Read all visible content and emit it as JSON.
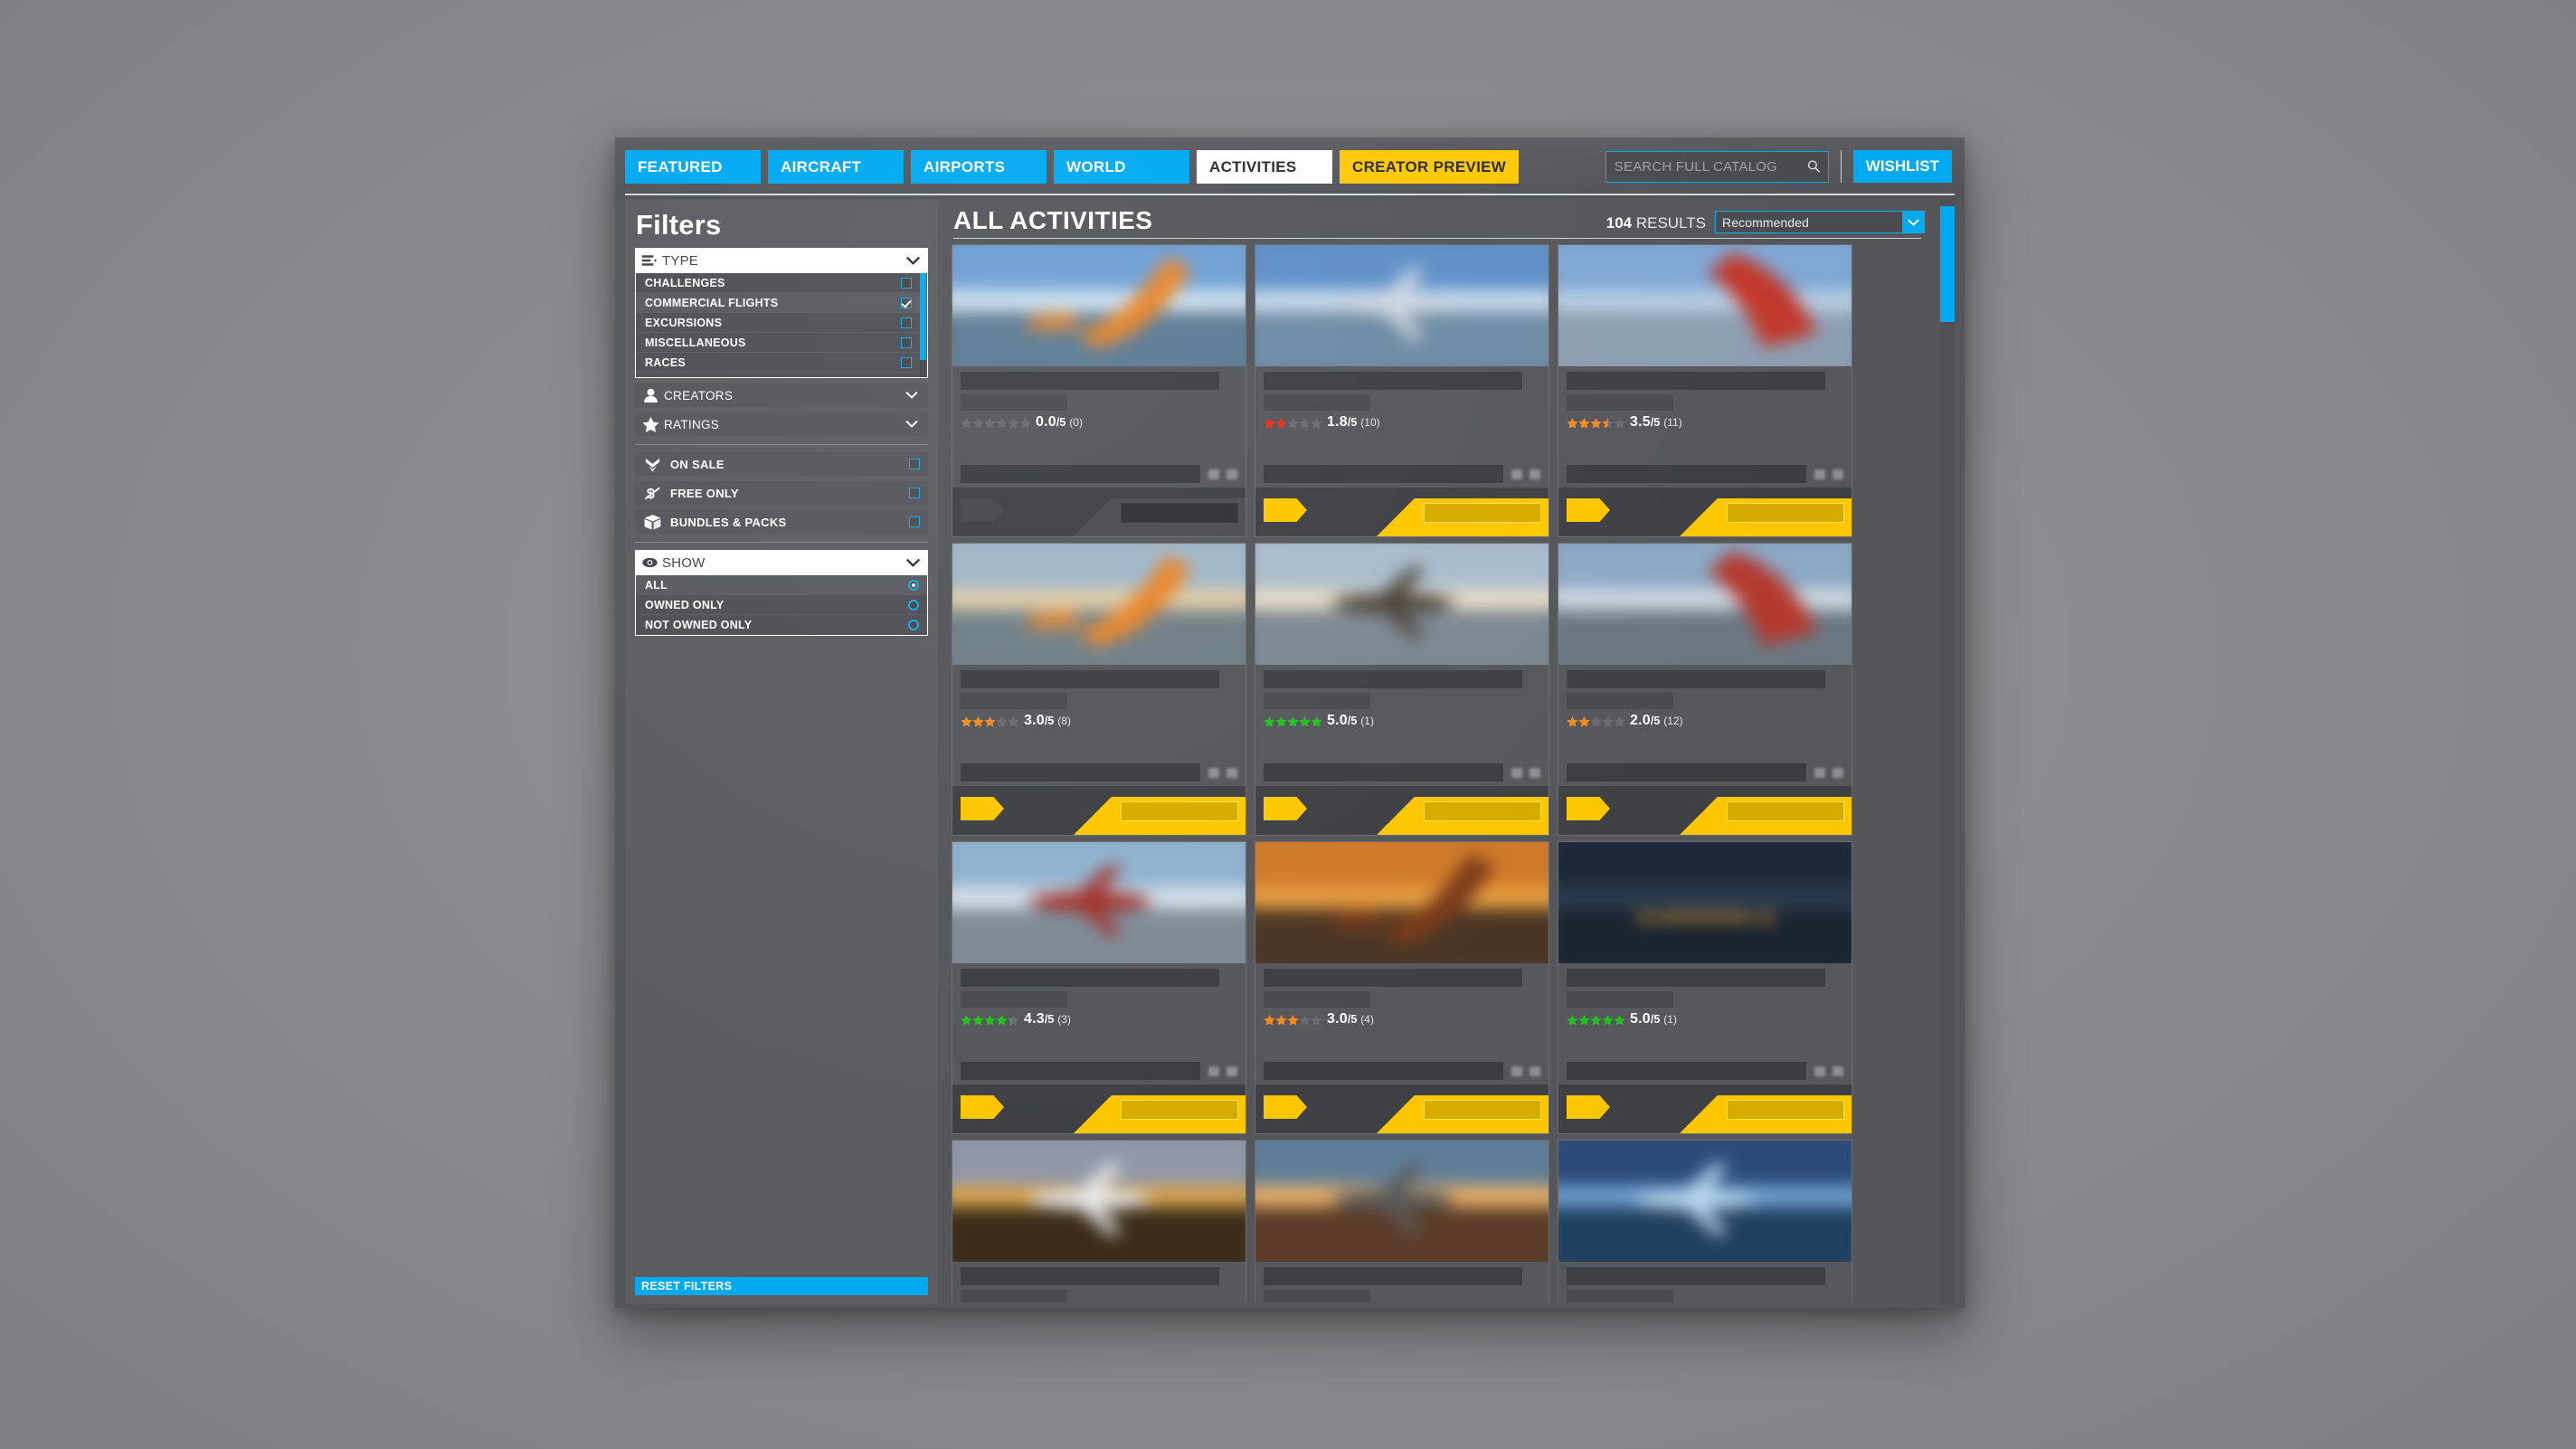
{
  "nav": {
    "tabs": [
      {
        "label": "FEATURED",
        "active": false
      },
      {
        "label": "AIRCRAFT",
        "active": false
      },
      {
        "label": "AIRPORTS",
        "active": false
      },
      {
        "label": "WORLD",
        "active": false
      },
      {
        "label": "ACTIVITIES",
        "active": true
      }
    ],
    "creator_preview": "CREATOR PREVIEW",
    "wishlist": "WISHLIST",
    "search_placeholder": "SEARCH FULL CATALOG",
    "search_value": ""
  },
  "sidebar": {
    "title": "Filters",
    "type_section": {
      "label": "TYPE",
      "icon": "list-icon",
      "options": [
        {
          "label": "CHALLENGES",
          "checked": false
        },
        {
          "label": "COMMERCIAL FLIGHTS",
          "checked": true
        },
        {
          "label": "EXCURSIONS",
          "checked": false
        },
        {
          "label": "MISCELLANEOUS",
          "checked": false
        },
        {
          "label": "RACES",
          "checked": false
        }
      ]
    },
    "collapsed_sections": [
      {
        "label": "CREATORS",
        "icon": "person-icon"
      },
      {
        "label": "RATINGS",
        "icon": "star-icon"
      }
    ],
    "toggles": [
      {
        "label": "ON SALE",
        "icon": "double-chevron-down-icon",
        "checked": false
      },
      {
        "label": "FREE ONLY",
        "icon": "no-money-icon",
        "checked": false
      },
      {
        "label": "BUNDLES & PACKS",
        "icon": "box-icon",
        "checked": false
      }
    ],
    "show_section": {
      "label": "SHOW",
      "icon": "eye-icon",
      "options": [
        {
          "label": "ALL",
          "selected": true
        },
        {
          "label": "OWNED ONLY",
          "selected": false
        },
        {
          "label": "NOT OWNED ONLY",
          "selected": false
        }
      ]
    },
    "reset_label": "RESET FILTERS"
  },
  "main": {
    "page_title": "ALL ACTIVITIES",
    "results_count": "104",
    "results_label": "RESULTS",
    "sort_value": "Recommended",
    "cards": [
      {
        "rating": "0.0",
        "denominator": "/5",
        "count": "(0)",
        "stars": 0,
        "star_color": "#6d6e72",
        "placeholder_action": true,
        "img": {
          "sky_top": "#6d9fd4",
          "sky_mid": "#cfe3f2",
          "ground": "#5c7b93",
          "accent": "#e8862a",
          "accent_shape": "wing"
        }
      },
      {
        "rating": "1.8",
        "denominator": "/5",
        "count": "(10)",
        "stars": 2,
        "star_color": "#f02b17",
        "placeholder_action": false,
        "img": {
          "sky_top": "#5d8fc7",
          "sky_mid": "#c9dcee",
          "ground": "#6d8aa3",
          "accent": "#cfd8e2",
          "accent_shape": "plane"
        }
      },
      {
        "rating": "3.5",
        "denominator": "/5",
        "count": "(11)",
        "stars": 3.5,
        "star_color": "#f08b1e",
        "placeholder_action": false,
        "img": {
          "sky_top": "#7fa8d4",
          "sky_mid": "#b7cee4",
          "ground": "#8d9fb3",
          "accent": "#c0392b",
          "accent_shape": "tail"
        }
      },
      {
        "rating": "3.0",
        "denominator": "/5",
        "count": "(8)",
        "stars": 3,
        "star_color": "#f08b1e",
        "placeholder_action": false,
        "img": {
          "sky_top": "#9fb7c9",
          "sky_mid": "#e0cda8",
          "ground": "#6f7f87",
          "accent": "#e8862a",
          "accent_shape": "wing"
        }
      },
      {
        "rating": "5.0",
        "denominator": "/5",
        "count": "(1)",
        "stars": 5,
        "star_color": "#22c01e",
        "placeholder_action": false,
        "img": {
          "sky_top": "#a8bccd",
          "sky_mid": "#e8ddc8",
          "ground": "#7b8790",
          "accent": "#4a4238",
          "accent_shape": "plane"
        }
      },
      {
        "rating": "2.0",
        "denominator": "/5",
        "count": "(12)",
        "stars": 2,
        "star_color": "#f08b1e",
        "placeholder_action": false,
        "img": {
          "sky_top": "#8ca8c4",
          "sky_mid": "#cfd9e2",
          "ground": "#6a7782",
          "accent": "#b33a2e",
          "accent_shape": "tail"
        }
      },
      {
        "rating": "4.3",
        "denominator": "/5",
        "count": "(3)",
        "stars": 4.3,
        "star_color": "#22c01e",
        "placeholder_action": false,
        "img": {
          "sky_top": "#8fb2cf",
          "sky_mid": "#d6e2ec",
          "ground": "#7e8c98",
          "accent": "#a03028",
          "accent_shape": "plane"
        }
      },
      {
        "rating": "3.0",
        "denominator": "/5",
        "count": "(4)",
        "stars": 3,
        "star_color": "#f08b1e",
        "placeholder_action": false,
        "img": {
          "sky_top": "#d07a2a",
          "sky_mid": "#e8a040",
          "ground": "#4a3524",
          "accent": "#7a3a18",
          "accent_shape": "wing"
        }
      },
      {
        "rating": "5.0",
        "denominator": "/5",
        "count": "(1)",
        "stars": 5,
        "star_color": "#22c01e",
        "placeholder_action": false,
        "img": {
          "sky_top": "#1b2838",
          "sky_mid": "#2b3c4e",
          "ground": "#1a2430",
          "accent": "#e8a23a",
          "accent_shape": "runway"
        }
      },
      {
        "rating": "",
        "denominator": "",
        "count": "",
        "stars": 0,
        "star_color": "#6d6e72",
        "placeholder_action": false,
        "img": {
          "sky_top": "#9098a8",
          "sky_mid": "#d8a44e",
          "ground": "#3a2c18",
          "accent": "#e8e8e8",
          "accent_shape": "plane"
        }
      },
      {
        "rating": "",
        "denominator": "",
        "count": "",
        "stars": 0,
        "star_color": "#6d6e72",
        "placeholder_action": false,
        "img": {
          "sky_top": "#5f7d98",
          "sky_mid": "#e8b068",
          "ground": "#5a3c28",
          "accent": "#5a5a5a",
          "accent_shape": "plane"
        }
      },
      {
        "rating": "",
        "denominator": "",
        "count": "",
        "stars": 0,
        "star_color": "#6d6e72",
        "placeholder_action": false,
        "img": {
          "sky_top": "#2a4a7a",
          "sky_mid": "#6f9fd0",
          "ground": "#20405f",
          "accent": "#b8d8ee",
          "accent_shape": "plane"
        }
      }
    ]
  },
  "colors": {
    "accent_blue": "#00a9f0",
    "accent_yellow": "#ffc806",
    "panel": "#55565a"
  }
}
